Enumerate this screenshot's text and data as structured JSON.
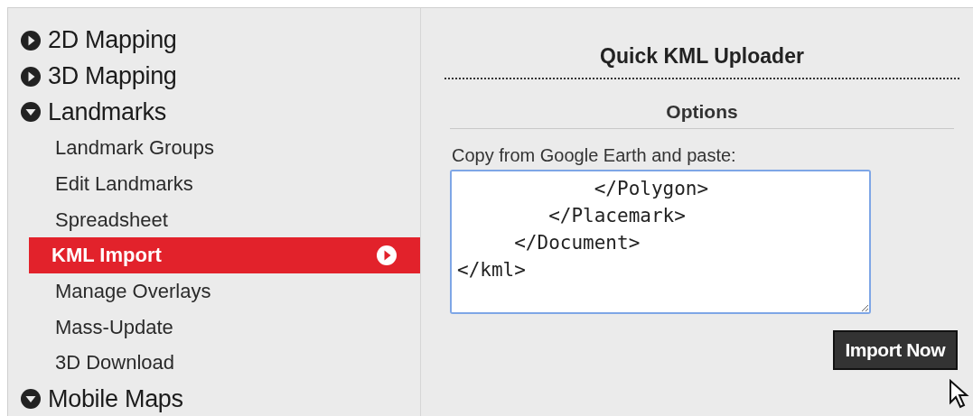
{
  "sidebar": {
    "sections": [
      {
        "label": "2D Mapping",
        "expanded": false
      },
      {
        "label": "3D Mapping",
        "expanded": false
      },
      {
        "label": "Landmarks",
        "expanded": true,
        "items": [
          {
            "label": "Landmark Groups",
            "selected": false
          },
          {
            "label": "Edit Landmarks",
            "selected": false
          },
          {
            "label": "Spreadsheet",
            "selected": false
          },
          {
            "label": "KML Import",
            "selected": true
          },
          {
            "label": "Manage Overlays",
            "selected": false
          },
          {
            "label": "Mass-Update",
            "selected": false
          },
          {
            "label": "3D Download",
            "selected": false
          }
        ]
      },
      {
        "label": "Mobile Maps",
        "expanded": true
      }
    ]
  },
  "panel": {
    "title": "Quick KML Uploader",
    "section": "Options",
    "field_label": "Copy from Google Earth and paste:",
    "textarea": {
      "value": "            </Polygon>\n        </Placemark>\n     </Document>\n</kml>\n"
    },
    "button": "Import Now"
  }
}
